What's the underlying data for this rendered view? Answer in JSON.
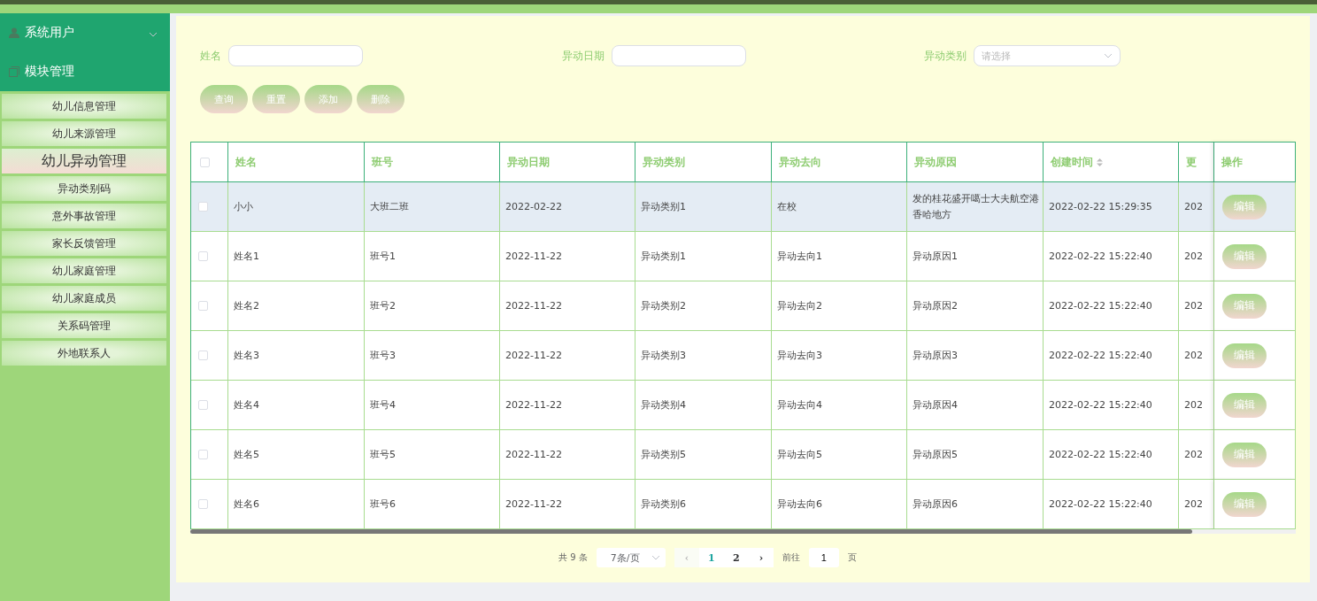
{
  "sidebar": {
    "groups": [
      {
        "label": "系统用户",
        "kind": "user",
        "expanded": false
      },
      {
        "label": "模块管理",
        "kind": "module",
        "expanded": true,
        "items": [
          {
            "label": "幼儿信息管理",
            "selected": false
          },
          {
            "label": "幼儿来源管理",
            "selected": false
          },
          {
            "label": "幼儿异动管理",
            "selected": true
          },
          {
            "label": "异动类别码",
            "selected": false
          },
          {
            "label": "意外事故管理",
            "selected": false
          },
          {
            "label": "家长反馈管理",
            "selected": false
          },
          {
            "label": "幼儿家庭管理",
            "selected": false
          },
          {
            "label": "幼儿家庭成员",
            "selected": false
          },
          {
            "label": "关系码管理",
            "selected": false
          },
          {
            "label": "外地联系人",
            "selected": false
          }
        ]
      }
    ]
  },
  "filters": [
    {
      "label": "姓名",
      "kind": "text"
    },
    {
      "label": "异动日期",
      "kind": "text"
    },
    {
      "label": "异动类别",
      "kind": "select",
      "placeholder": "请选择"
    }
  ],
  "actions": [
    "查询",
    "重置",
    "添加",
    "删除"
  ],
  "table": {
    "header_checked": false,
    "columns": [
      "姓名",
      "班号",
      "异动日期",
      "异动类别",
      "异动去向",
      "异动原因",
      "创建时间",
      "更"
    ],
    "action_column": "操作",
    "rows": [
      {
        "checked": false,
        "highlighted": true,
        "cells": [
          "小小",
          "大班二班",
          "2022-02-22",
          "异动类别1",
          "在校",
          "发的桂花盛开噶士大夫航空港香哈地方",
          "2022-02-22 15:29:35",
          "202"
        ],
        "action": "编辑"
      },
      {
        "checked": false,
        "highlighted": false,
        "cells": [
          "姓名1",
          "班号1",
          "2022-11-22",
          "异动类别1",
          "异动去向1",
          "异动原因1",
          "2022-02-22 15:22:40",
          "202"
        ],
        "action": "编辑"
      },
      {
        "checked": false,
        "highlighted": false,
        "cells": [
          "姓名2",
          "班号2",
          "2022-11-22",
          "异动类别2",
          "异动去向2",
          "异动原因2",
          "2022-02-22 15:22:40",
          "202"
        ],
        "action": "编辑"
      },
      {
        "checked": false,
        "highlighted": false,
        "cells": [
          "姓名3",
          "班号3",
          "2022-11-22",
          "异动类别3",
          "异动去向3",
          "异动原因3",
          "2022-02-22 15:22:40",
          "202"
        ],
        "action": "编辑"
      },
      {
        "checked": false,
        "highlighted": false,
        "cells": [
          "姓名4",
          "班号4",
          "2022-11-22",
          "异动类别4",
          "异动去向4",
          "异动原因4",
          "2022-02-22 15:22:40",
          "202"
        ],
        "action": "编辑"
      },
      {
        "checked": false,
        "highlighted": false,
        "cells": [
          "姓名5",
          "班号5",
          "2022-11-22",
          "异动类别5",
          "异动去向5",
          "异动原因5",
          "2022-02-22 15:22:40",
          "202"
        ],
        "action": "编辑"
      },
      {
        "checked": false,
        "highlighted": false,
        "cells": [
          "姓名6",
          "班号6",
          "2022-11-22",
          "异动类别6",
          "异动去向6",
          "异动原因6",
          "2022-02-22 15:22:40",
          "202"
        ],
        "action": "编辑"
      }
    ]
  },
  "pagination": {
    "total": "共 9 条",
    "page_size": "7条/页",
    "prev": "‹",
    "pages": [
      {
        "label": "1",
        "selected": true
      },
      {
        "label": "2",
        "selected": false
      }
    ],
    "next": "›",
    "goto_label": "前往",
    "goto_value": "1",
    "goto_suffix": "页"
  }
}
